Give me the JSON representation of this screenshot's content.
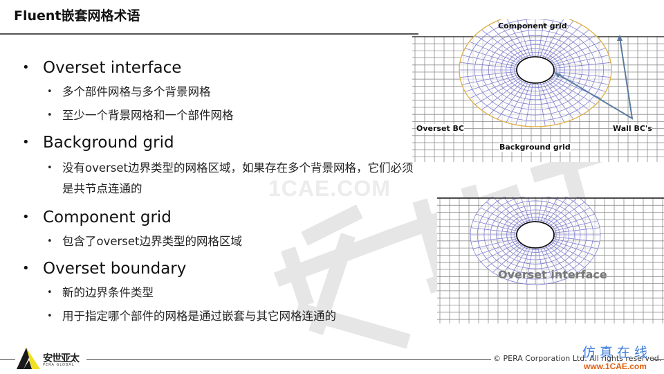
{
  "slide": {
    "title": "Fluent嵌套网格术语"
  },
  "bullets": [
    {
      "heading": "Overset interface",
      "items": [
        "多个部件网格与多个背景网格",
        "至少一个背景网格和一个部件网格"
      ]
    },
    {
      "heading": "Background grid",
      "items": [
        "没有overset边界类型的网格区域，如果存在多个背景网格，它们必须是共节点连通的"
      ]
    },
    {
      "heading": "Component grid",
      "items": [
        "包含了overset边界类型的网格区域"
      ]
    },
    {
      "heading": "Overset boundary",
      "items": [
        "新的边界条件类型",
        "用于指定哪个部件的网格是通过嵌套与其它网格连通的"
      ]
    }
  ],
  "diagram_top": {
    "labels": {
      "component_grid": "Component grid",
      "overset_bc": "Overset BC",
      "wall_bcs": "Wall BC's",
      "background_grid": "Background grid"
    },
    "colors": {
      "grid": "#8a8a8a",
      "component_mesh": "#6b6bc8",
      "overset_boundary": "#e0b040",
      "arrow": "#5a7aa0"
    }
  },
  "diagram_bottom": {
    "labels": {
      "overset_interface": "Overset interface"
    }
  },
  "watermarks": {
    "site": "1CAE.COM",
    "brand": "安世亚太"
  },
  "footer": {
    "logo_cn": "安世亚太",
    "logo_en": "PERA GLOBAL",
    "copyright": "©  PERA Corporation Ltd. All rights reserved.",
    "site_cn": "仿真在线",
    "site_url": "www.1CAE.com",
    "logo_colors": {
      "yellow": "#f0e020",
      "black": "#1a1a1a"
    }
  }
}
